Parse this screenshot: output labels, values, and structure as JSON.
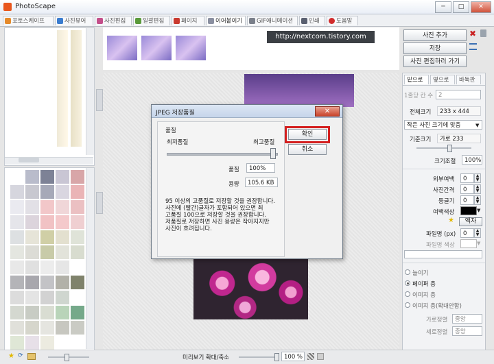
{
  "window": {
    "title": "PhotoScape"
  },
  "tabs": [
    "포토스케이프",
    "사진뷰어",
    "사진편집",
    "일괄편집",
    "페이지",
    "이어붙이기",
    "GIF애니메이션",
    "인쇄",
    "도움말"
  ],
  "overlay": {
    "url": "http://nextcom.tistory.com"
  },
  "right_buttons": {
    "add_photo": "사진 추가",
    "save": "저장",
    "go_edit": "사진 편집하러 가기"
  },
  "panel": {
    "tabs": [
      "밑으로",
      "옆으로",
      "바둑판"
    ],
    "per_row_label": "1줄당 칸 수",
    "per_row_value": "2",
    "total_size_label": "전체크기",
    "total_size_value": "233 x 444",
    "fit_select": "작은 사진 크기에 맞춤",
    "base_size_label": "기준크기",
    "base_size_value": "가로 233",
    "zoom_label": "크기조절",
    "zoom_value": "100%",
    "outer_margin_label": "외부여백",
    "outer_margin_value": "0",
    "spacing_label": "사진간격",
    "spacing_value": "0",
    "round_label": "둥글기",
    "round_value": "0",
    "margin_color_label": "여백색상",
    "frame_button": "액자",
    "file_border_label": "파일명 (px)",
    "file_border_value": "0",
    "file_color_label": "파일명 색상",
    "radio_options": [
      "늘이기",
      "페이퍼 층",
      "이미지 층",
      "이미지 층(확대안함)"
    ],
    "h_align_label": "가로정렬",
    "h_align_value": "중앙",
    "v_align_label": "세로정렬",
    "v_align_value": "중앙"
  },
  "status": {
    "zoom_label": "미리보기 확대/축소",
    "zoom_value": "100 %"
  },
  "dialog": {
    "title": "JPEG 저장품질",
    "group_label": "품질",
    "min_label": "최저품질",
    "max_label": "최고품질",
    "quality_label": "품질",
    "quality_value": "100%",
    "size_label": "용량",
    "size_value": "105.6 KB",
    "ok_button": "확인",
    "cancel_button": "취소",
    "note_lines": [
      "95 이상의 고품질로 저장할 것을 권장합니다.",
      "사진에 (빨간)글자가 포함되어 있으면 최",
      "고품질 100으로 저장할 것을 권장합니다.",
      "저품질로 저장하면 사진 용량은 작아지지만",
      "사진이 흐려집니다."
    ]
  },
  "colors": {
    "ok_highlight": "#d42020",
    "accent": "#3a6fb3"
  }
}
